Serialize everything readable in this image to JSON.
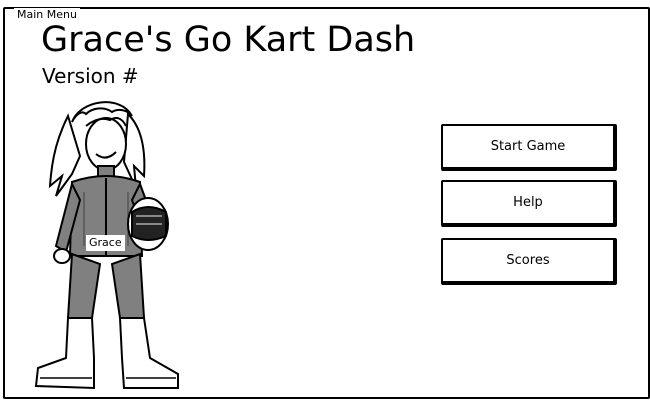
{
  "window": {
    "label": "Main Menu"
  },
  "header": {
    "title": "Grace's Go Kart Dash",
    "version": "Version #"
  },
  "character": {
    "name": "Grace",
    "icon": "racer-character-illustration"
  },
  "menu": {
    "start_label": "Start Game",
    "help_label": "Help",
    "scores_label": "Scores"
  },
  "colors": {
    "outline": "#000000",
    "suit": "#808080",
    "background": "#ffffff"
  }
}
